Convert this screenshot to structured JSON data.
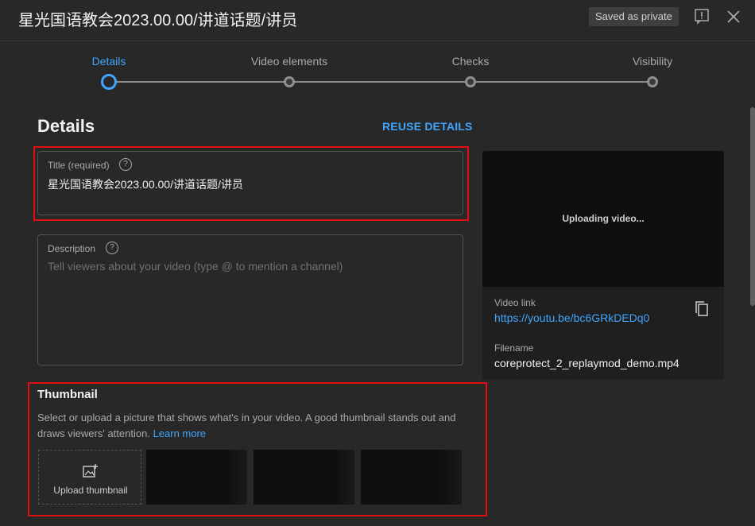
{
  "header": {
    "title": "星光国语教会2023.00.00/讲道话题/讲员",
    "saved_badge": "Saved as private",
    "feedback_icon": "feedback-icon",
    "close_icon": "close-icon"
  },
  "stepper": {
    "steps": [
      {
        "label": "Details",
        "active": true
      },
      {
        "label": "Video elements",
        "active": false
      },
      {
        "label": "Checks",
        "active": false
      },
      {
        "label": "Visibility",
        "active": false
      }
    ]
  },
  "details": {
    "heading": "Details",
    "reuse_label": "REUSE DETAILS",
    "title_field": {
      "label": "Title (required)",
      "value": "星光国语教会2023.00.00/讲道话题/讲员"
    },
    "description_field": {
      "label": "Description",
      "placeholder": "Tell viewers about your video (type @ to mention a channel)"
    }
  },
  "thumbnail": {
    "heading": "Thumbnail",
    "description": "Select or upload a picture that shows what's in your video. A good thumbnail stands out and draws viewers' attention.",
    "learn_more": "Learn more",
    "upload_label": "Upload thumbnail"
  },
  "side_panel": {
    "uploading_text": "Uploading video...",
    "video_link_label": "Video link",
    "video_link": "https://youtu.be/bc6GRkDEDq0",
    "filename_label": "Filename",
    "filename": "coreprotect_2_replaymod_demo.mp4"
  },
  "colors": {
    "accent": "#3ea6ff",
    "highlight": "#e01010",
    "background": "#282828"
  }
}
